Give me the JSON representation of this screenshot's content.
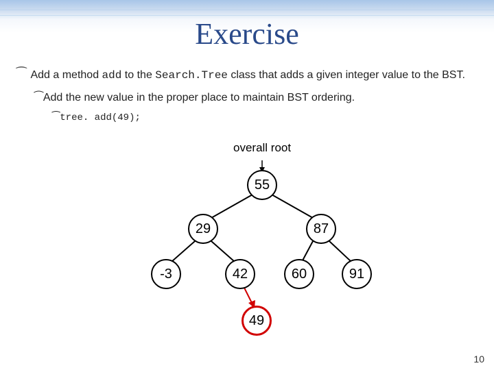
{
  "title": "Exercise",
  "bullet1_a": "Add a method ",
  "bullet1_code1": "add",
  "bullet1_b": " to the ",
  "bullet1_code2": "Search.Tree",
  "bullet1_c": " class that adds a given integer value to the BST.",
  "bullet2": "Add the new value in the proper place to maintain BST ordering.",
  "bullet3_code": "tree. add(49);",
  "overall_root_label": "overall root",
  "tree": {
    "nodes": {
      "n55": "55",
      "n29": "29",
      "n87": "87",
      "nm3": "-3",
      "n42": "42",
      "n60": "60",
      "n91": "91",
      "n49": "49"
    }
  },
  "page_number": "10"
}
